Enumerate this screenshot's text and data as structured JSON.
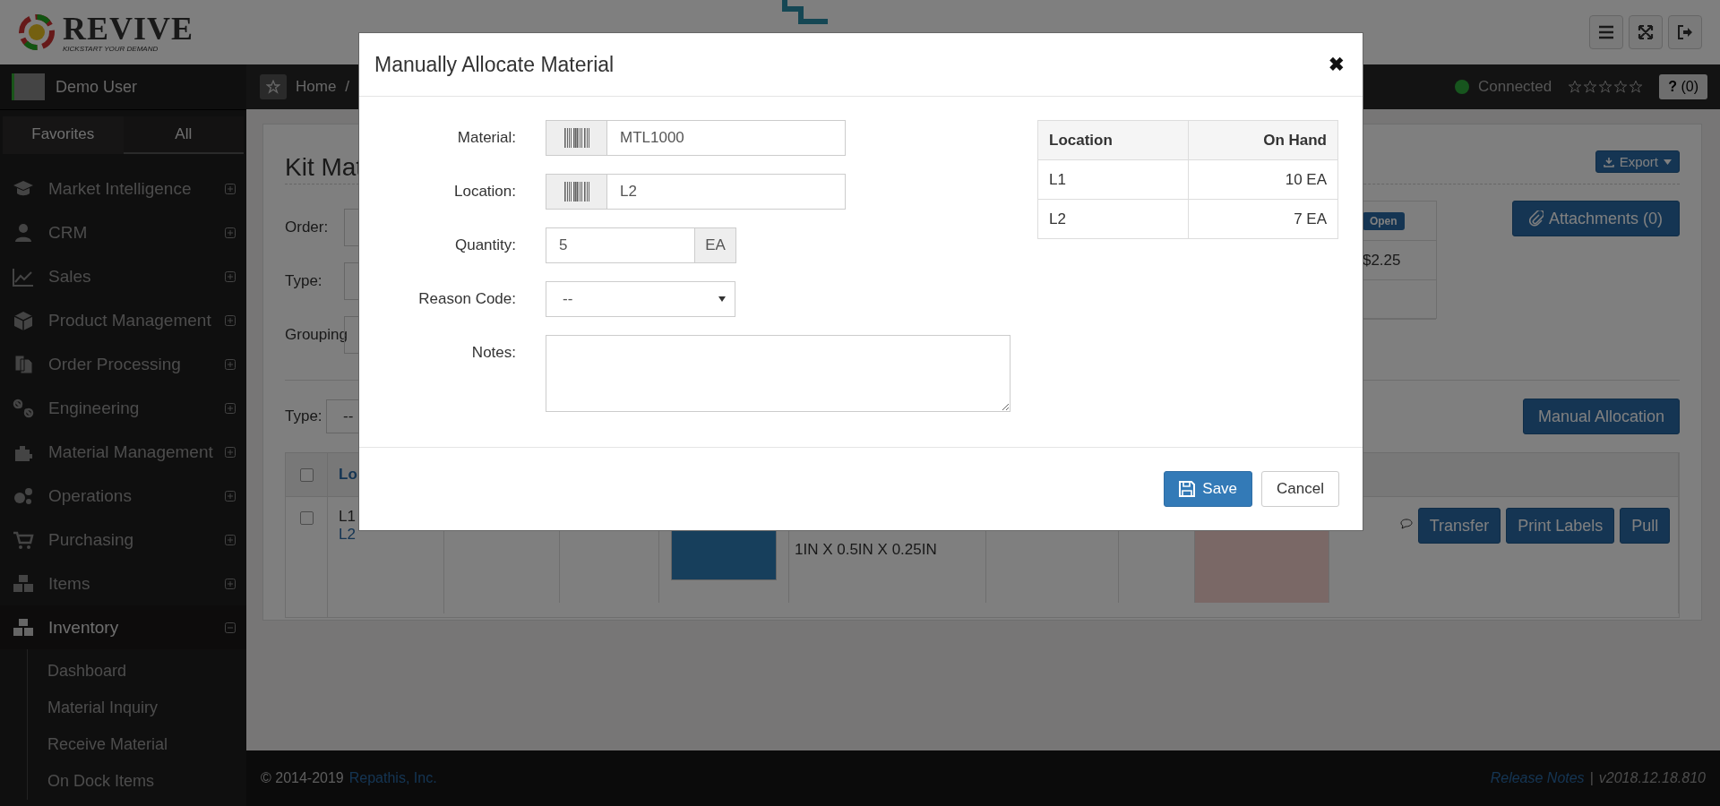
{
  "header": {
    "logo": {
      "name": "REVIVE",
      "tagline": "KICKSTART YOUR DEMAND"
    }
  },
  "top_bar": {
    "user": "Demo User",
    "breadcrumb": [
      "Home",
      "/"
    ],
    "status": "Connected",
    "connected": true,
    "stars": 0,
    "help": {
      "label": "?",
      "count": "(0)"
    }
  },
  "sidebar": {
    "tabs": [
      {
        "label": "Favorites",
        "selected": false
      },
      {
        "label": "All",
        "selected": true
      }
    ],
    "items": [
      {
        "label": "Market Intelligence",
        "expanded": false
      },
      {
        "label": "CRM",
        "expanded": false
      },
      {
        "label": "Sales",
        "expanded": false
      },
      {
        "label": "Product Management",
        "expanded": false
      },
      {
        "label": "Order Processing",
        "expanded": false
      },
      {
        "label": "Engineering",
        "expanded": false
      },
      {
        "label": "Material Management",
        "expanded": false
      },
      {
        "label": "Operations",
        "expanded": false
      },
      {
        "label": "Purchasing",
        "expanded": false
      },
      {
        "label": "Items",
        "expanded": false
      },
      {
        "label": "Inventory",
        "expanded": true,
        "children": [
          {
            "label": "Dashboard"
          },
          {
            "label": "Material Inquiry"
          },
          {
            "label": "Receive Material"
          },
          {
            "label": "On Dock Items"
          }
        ]
      }
    ]
  },
  "page": {
    "title": "Kit Mat",
    "export": "Export",
    "filters": [
      {
        "label": "Order:"
      },
      {
        "label": "Type:"
      },
      {
        "label": "Grouping"
      }
    ],
    "summary": {
      "badge": "Open",
      "price": "$2.25"
    },
    "attachments": "Attachments (0)",
    "type_filter": {
      "label": "Type:",
      "value": "--"
    },
    "manual_allocation": "Manual Allocation",
    "table": {
      "header": "Lo",
      "select_all": false,
      "row": {
        "locations": [
          "L1",
          "L2"
        ],
        "checked": false,
        "dimensions": "1IN X 0.5IN X 0.25IN",
        "actions": [
          "Transfer",
          "Print Labels",
          "Pull"
        ]
      }
    }
  },
  "modal": {
    "title": "Manually Allocate Material",
    "close": "✖",
    "fields": [
      {
        "kind": "scan",
        "label": "Material:",
        "value": "MTL1000"
      },
      {
        "kind": "scan",
        "label": "Location:",
        "value": "L2"
      },
      {
        "kind": "unit",
        "label": "Quantity:",
        "value": "5",
        "unit": "EA"
      },
      {
        "kind": "select",
        "label": "Reason Code:",
        "value": "--"
      },
      {
        "kind": "textarea",
        "label": "Notes:"
      }
    ],
    "stock_table": {
      "columns": [
        "Location",
        "On Hand"
      ],
      "rows": [
        {
          "location": "L1",
          "on_hand": "10 EA"
        },
        {
          "location": "L2",
          "on_hand": "7 EA"
        }
      ]
    },
    "buttons": {
      "save": "Save",
      "cancel": "Cancel"
    }
  },
  "footer": {
    "copyright": "© 2014-2019",
    "company": "Repathis, Inc.",
    "release_notes": "Release Notes",
    "separator": "|",
    "version": "v2018.12.18.810"
  }
}
